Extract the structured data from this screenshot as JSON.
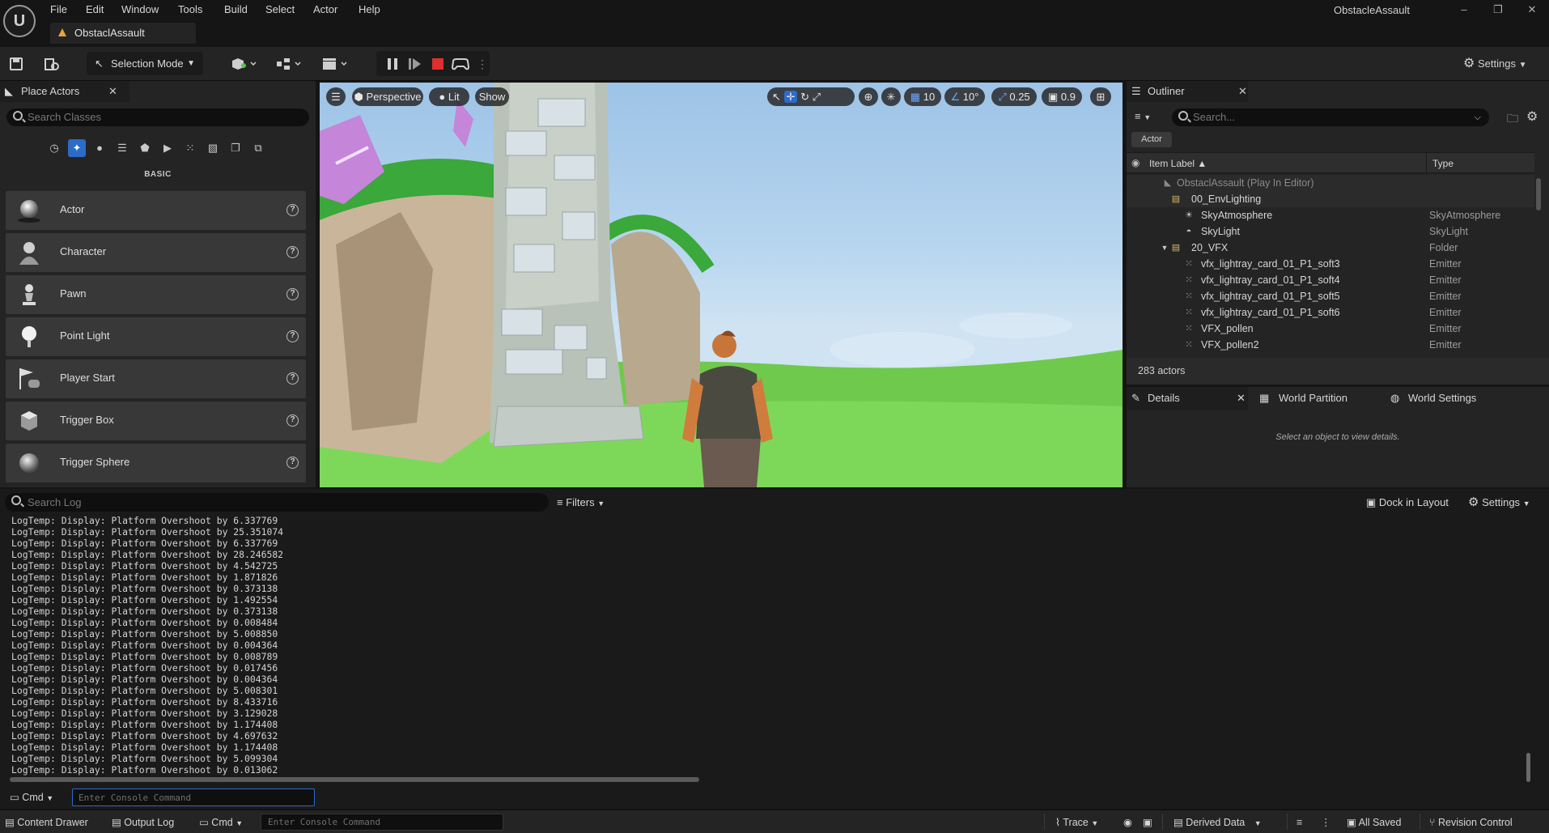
{
  "app": {
    "window_title": "ObstacleAssault",
    "level_tab": "ObstaclAssault",
    "menu": [
      "File",
      "Edit",
      "Window",
      "Tools",
      "Build",
      "Select",
      "Actor",
      "Help"
    ],
    "window_controls": [
      "–",
      "❐",
      "✕"
    ]
  },
  "toolbar": {
    "selection_mode": "Selection Mode",
    "settings": "Settings"
  },
  "place_actors": {
    "title": "Place Actors",
    "search_placeholder": "Search Classes",
    "category": "BASIC",
    "items": [
      {
        "label": "Actor"
      },
      {
        "label": "Character"
      },
      {
        "label": "Pawn"
      },
      {
        "label": "Point Light"
      },
      {
        "label": "Player Start"
      },
      {
        "label": "Trigger Box"
      },
      {
        "label": "Trigger Sphere"
      }
    ]
  },
  "viewport": {
    "view_mode": "Perspective",
    "lighting": "Lit",
    "show": "Show",
    "grid_snap": "10",
    "rotation_snap": "10°",
    "scale_snap": "0.25",
    "camera_speed": "0.9"
  },
  "outliner": {
    "title": "Outliner",
    "search_placeholder": "Search...",
    "filter_chip": "Actor",
    "col_label": "Item Label ▲",
    "col_type": "Type",
    "rows": [
      {
        "name": "ObstaclAssault (Play In Editor)",
        "type": ""
      },
      {
        "name": "00_EnvLighting",
        "type": ""
      },
      {
        "name": "SkyAtmosphere",
        "type": "SkyAtmosphere"
      },
      {
        "name": "SkyLight",
        "type": "SkyLight"
      },
      {
        "name": "20_VFX",
        "type": "Folder"
      },
      {
        "name": "vfx_lightray_card_01_P1_soft3",
        "type": "Emitter"
      },
      {
        "name": "vfx_lightray_card_01_P1_soft4",
        "type": "Emitter"
      },
      {
        "name": "vfx_lightray_card_01_P1_soft5",
        "type": "Emitter"
      },
      {
        "name": "vfx_lightray_card_01_P1_soft6",
        "type": "Emitter"
      },
      {
        "name": "VFX_pollen",
        "type": "Emitter"
      },
      {
        "name": "VFX_pollen2",
        "type": "Emitter"
      }
    ],
    "actor_count": "283 actors"
  },
  "details": {
    "tabs": [
      "Details",
      "World Partition",
      "World Settings"
    ],
    "empty_message": "Select an object to view details."
  },
  "output_log": {
    "search_placeholder": "Search Log",
    "filters": "Filters",
    "dock_in_layout": "Dock in Layout",
    "settings": "Settings",
    "lines": [
      "LogTemp: Display: Platform Overshoot by 6.337769",
      "LogTemp: Display: Platform Overshoot by 25.351074",
      "LogTemp: Display: Platform Overshoot by 6.337769",
      "LogTemp: Display: Platform Overshoot by 28.246582",
      "LogTemp: Display: Platform Overshoot by 4.542725",
      "LogTemp: Display: Platform Overshoot by 1.871826",
      "LogTemp: Display: Platform Overshoot by 0.373138",
      "LogTemp: Display: Platform Overshoot by 1.492554",
      "LogTemp: Display: Platform Overshoot by 0.373138",
      "LogTemp: Display: Platform Overshoot by 0.008484",
      "LogTemp: Display: Platform Overshoot by 5.008850",
      "LogTemp: Display: Platform Overshoot by 0.004364",
      "LogTemp: Display: Platform Overshoot by 0.008789",
      "LogTemp: Display: Platform Overshoot by 0.017456",
      "LogTemp: Display: Platform Overshoot by 0.004364",
      "LogTemp: Display: Platform Overshoot by 5.008301",
      "LogTemp: Display: Platform Overshoot by 8.433716",
      "LogTemp: Display: Platform Overshoot by 3.129028",
      "LogTemp: Display: Platform Overshoot by 1.174408",
      "LogTemp: Display: Platform Overshoot by 4.697632",
      "LogTemp: Display: Platform Overshoot by 1.174408",
      "LogTemp: Display: Platform Overshoot by 5.099304",
      "LogTemp: Display: Platform Overshoot by 0.013062"
    ],
    "cmd_label": "Cmd",
    "cmd_placeholder": "Enter Console Command"
  },
  "statusbar": {
    "content_drawer": "Content Drawer",
    "output_log": "Output Log",
    "cmd": "Cmd",
    "cmd_placeholder": "Enter Console Command",
    "trace": "Trace",
    "derived_data": "Derived Data",
    "all_saved": "All Saved",
    "revision_control": "Revision Control"
  },
  "colors": {
    "accent": "#2d6bc9",
    "panel": "#242424",
    "background": "#151515",
    "stop_red": "#e02f2f"
  }
}
